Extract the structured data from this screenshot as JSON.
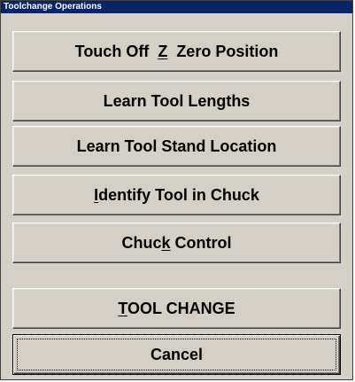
{
  "window": {
    "title": "Toolchange Operations"
  },
  "buttons": [
    {
      "pre": "Touch Off  ",
      "ul": "Z",
      "post": "  Zero Position"
    },
    {
      "pre": "Learn Tool Lengths",
      "ul": "",
      "post": ""
    },
    {
      "pre": "Learn Tool Stand Location",
      "ul": "",
      "post": ""
    },
    {
      "pre": "",
      "ul": "I",
      "post": "dentify Tool in Chuck"
    },
    {
      "pre": "Chuc",
      "ul": "k",
      "post": " Control"
    },
    {
      "pre": "",
      "ul": "T",
      "post": "OOL CHANGE"
    },
    {
      "pre": "Cancel",
      "ul": "",
      "post": ""
    }
  ],
  "colors": {
    "titlebar": "#0a246a",
    "face": "#d4d0c8"
  }
}
